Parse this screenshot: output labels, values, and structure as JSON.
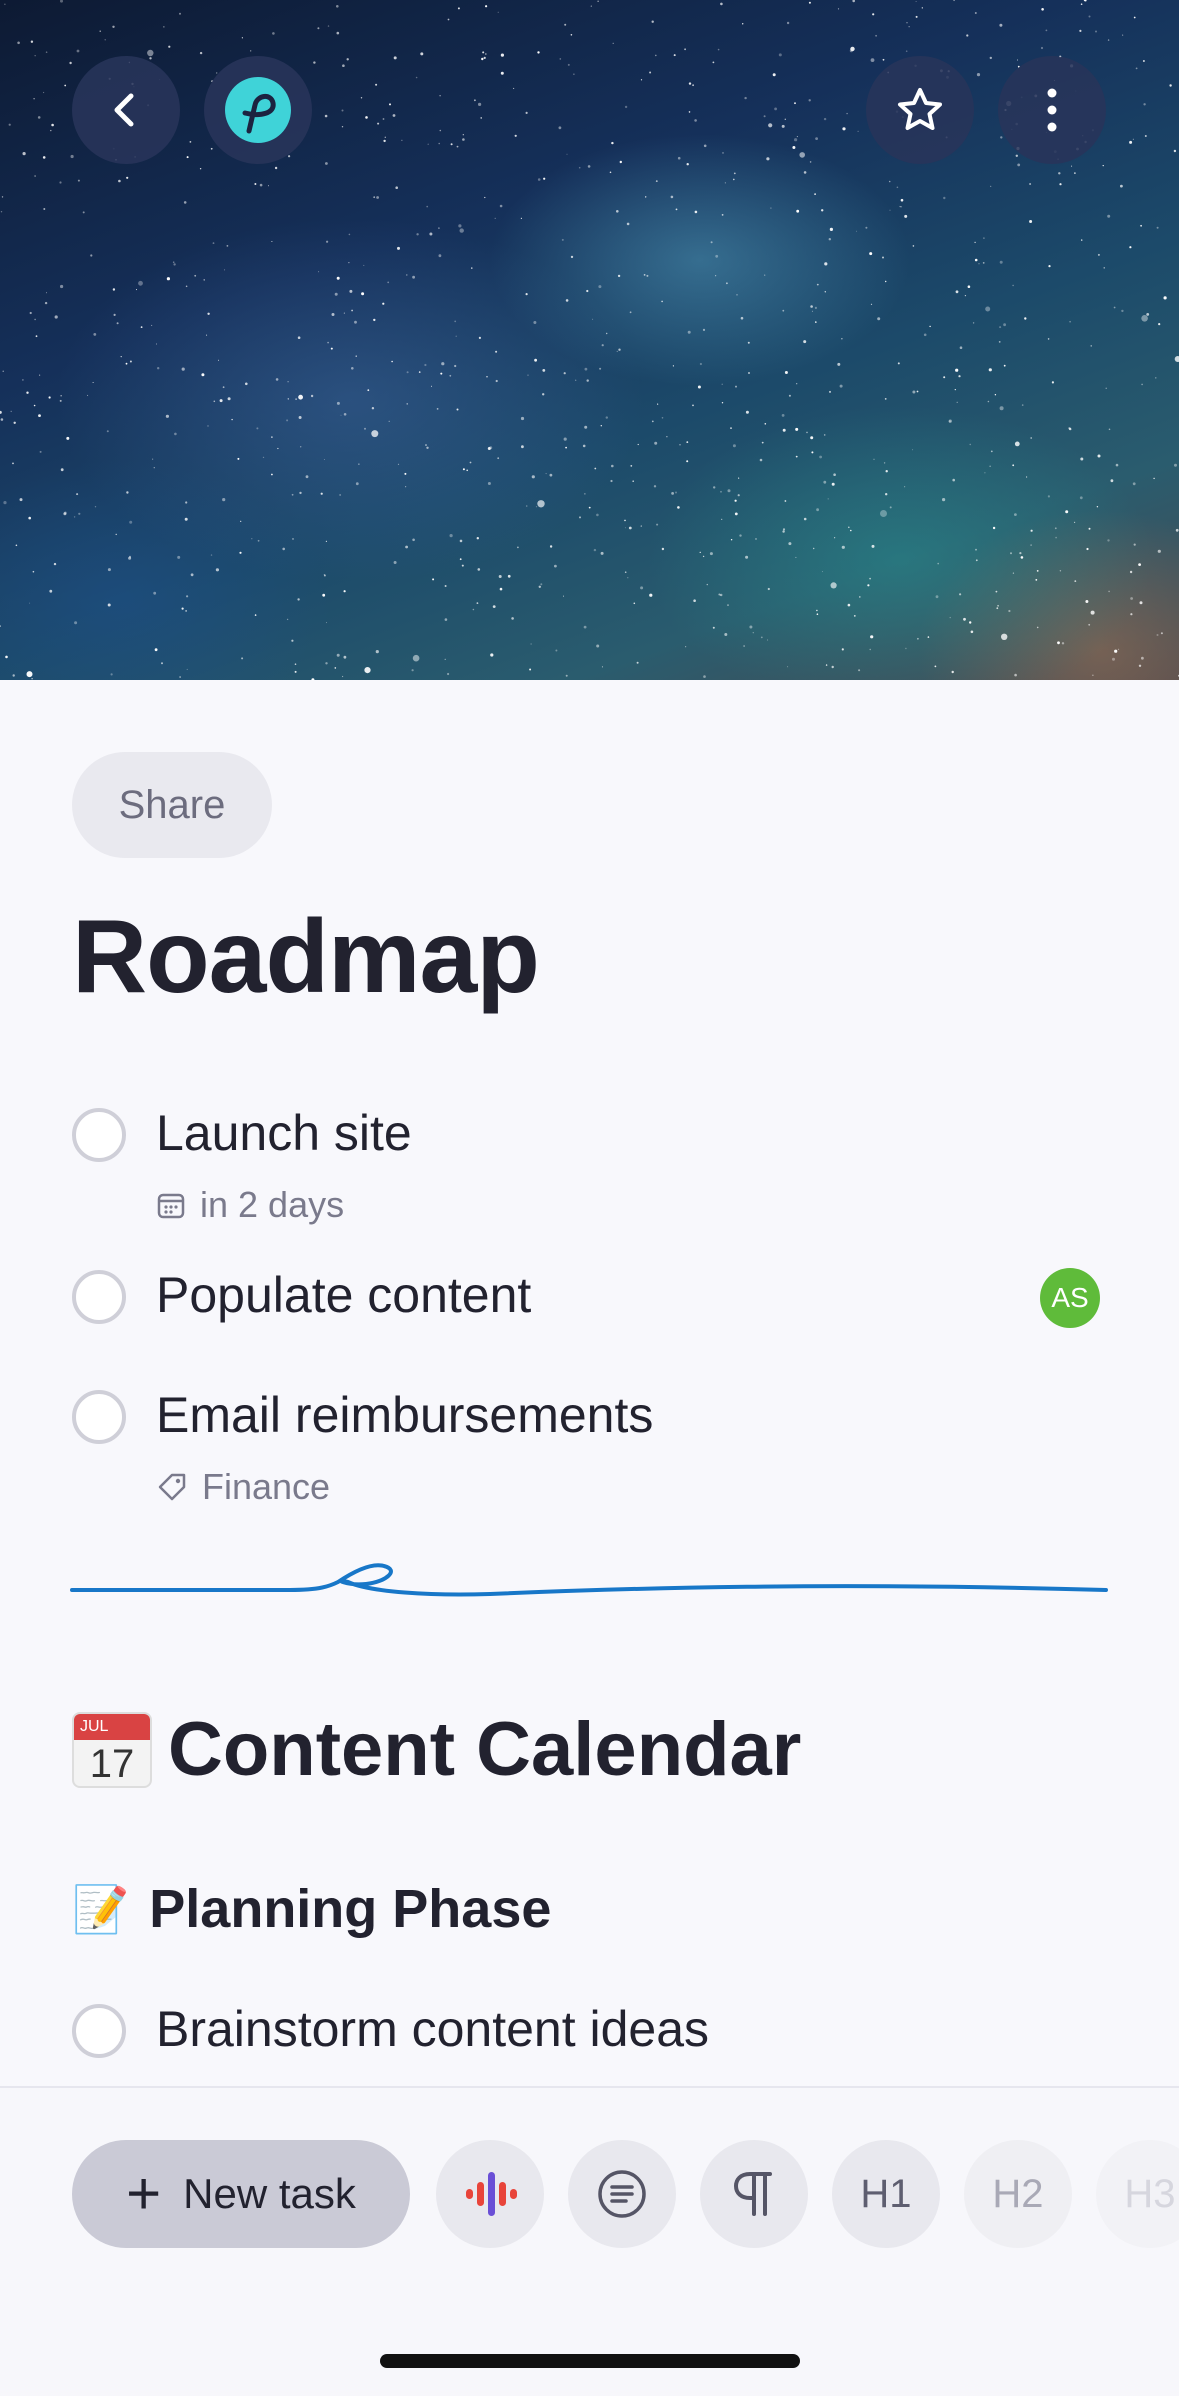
{
  "header": {
    "back_icon": "chevron-left-icon",
    "app_logo_icon": "app-logo-icon",
    "favorite_icon": "star-icon",
    "more_icon": "more-vertical-icon"
  },
  "share": {
    "label": "Share"
  },
  "page_title": "Roadmap",
  "tasks": [
    {
      "label": "Launch site",
      "meta": "in 2 days",
      "meta_icon": "calendar-icon"
    },
    {
      "label": "Populate content",
      "assignee_initials": "AS"
    },
    {
      "label": "Email reimbursements",
      "meta": "Finance",
      "meta_icon": "tag-icon"
    }
  ],
  "sections": {
    "content_calendar": {
      "emoji_month": "JUL",
      "emoji_day": "17",
      "label": "Content Calendar"
    },
    "planning_phase": {
      "emoji": "📝",
      "label": "Planning Phase"
    }
  },
  "planning_tasks": [
    {
      "label": "Brainstorm content ideas"
    }
  ],
  "toolbar": {
    "new_task_label": "New task",
    "h1_label": "H1",
    "h2_label": "H2",
    "h3_label": "H3"
  },
  "colors": {
    "accent_divider": "#1877c8",
    "avatar": "#5fbb3a",
    "logo": "#3fd3d8"
  }
}
